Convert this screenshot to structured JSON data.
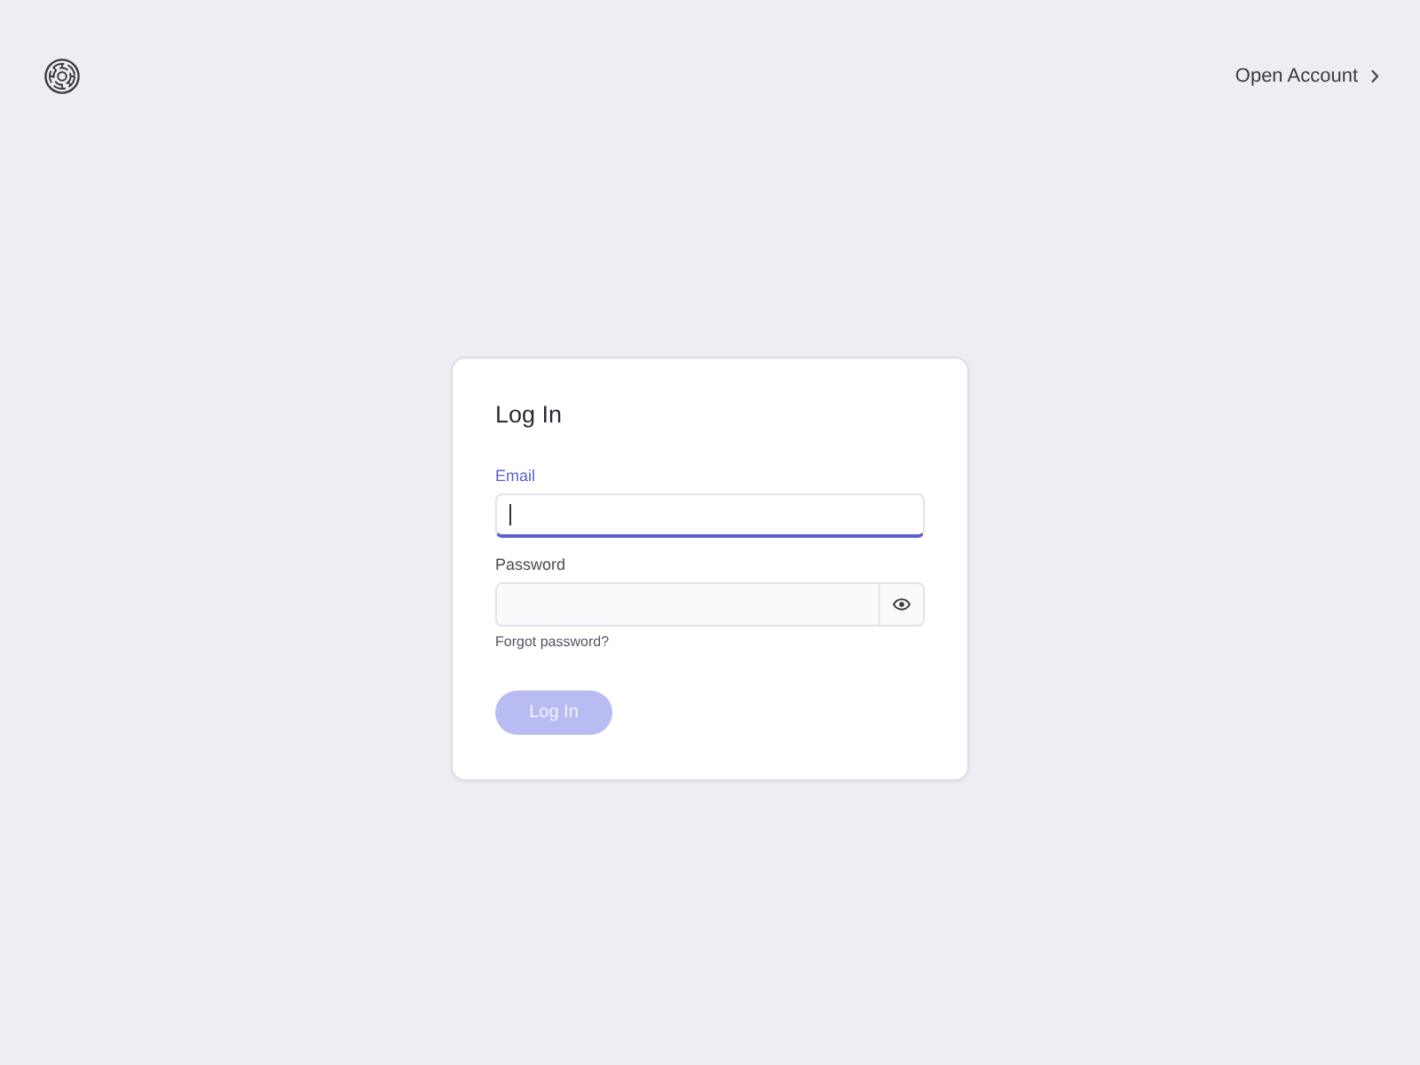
{
  "header": {
    "link": {
      "label": "Open Account"
    }
  },
  "login_card": {
    "title": "Log In",
    "fields": [
      {
        "kind": "text",
        "label": "Email",
        "focused": true
      },
      {
        "kind": "password",
        "label": "Password",
        "focused": false
      }
    ],
    "forgot_link": "Forgot password?",
    "submit_button": {
      "label": "Log In",
      "disabled": true
    }
  }
}
